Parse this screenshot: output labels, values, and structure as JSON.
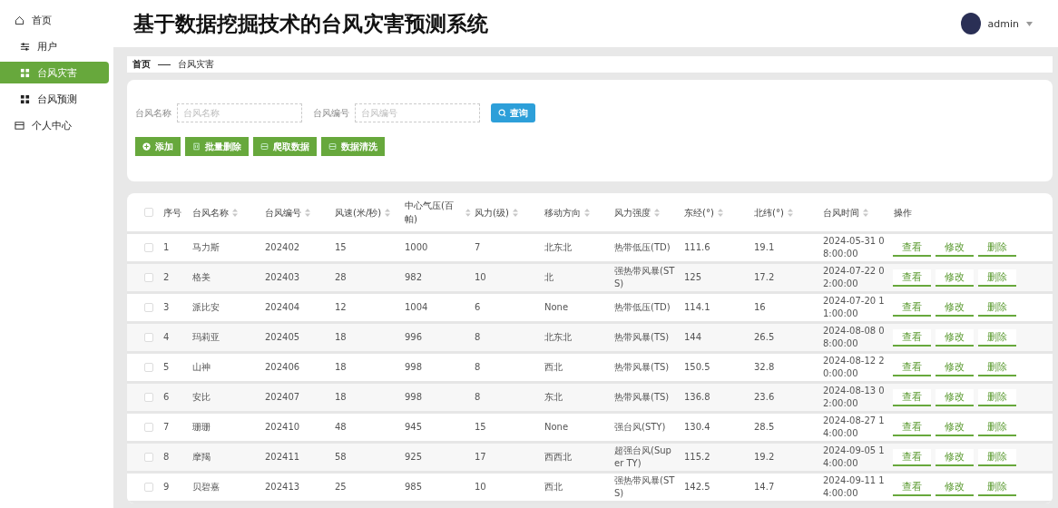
{
  "sidebar": {
    "items": [
      {
        "label": "首页",
        "kind": "home",
        "selected": false
      },
      {
        "label": "用户",
        "kind": "sliders",
        "selected": false
      },
      {
        "label": "台风灾害",
        "kind": "grid",
        "selected": true
      },
      {
        "label": "台风预测",
        "kind": "grid",
        "selected": false
      },
      {
        "label": "个人中心",
        "kind": "wallet",
        "selected": false
      }
    ]
  },
  "header": {
    "title": "基于数据挖掘技术的台风灾害预测系统",
    "user": "admin"
  },
  "breadcrumb": [
    "首页",
    "台风灾害"
  ],
  "search": {
    "fields": [
      {
        "label": "台风名称",
        "placeholder": "台风名称"
      },
      {
        "label": "台风编号",
        "placeholder": "台风编号"
      }
    ],
    "button": "查询"
  },
  "toolbar": [
    {
      "label": "添加",
      "kind": "plus"
    },
    {
      "label": "批量删除",
      "kind": "trash"
    },
    {
      "label": "爬取数据",
      "kind": "db"
    },
    {
      "label": "数据清洗",
      "kind": "db"
    }
  ],
  "table": {
    "header_checked": false,
    "columns": [
      {
        "label": "序号",
        "sortable": false
      },
      {
        "label": "台风名称",
        "sortable": true
      },
      {
        "label": "台风编号",
        "sortable": true
      },
      {
        "label": "风速(米/秒)",
        "sortable": true
      },
      {
        "label": "中心气压(百帕)",
        "sortable": true
      },
      {
        "label": "风力(级)",
        "sortable": true
      },
      {
        "label": "移动方向",
        "sortable": true
      },
      {
        "label": "风力强度",
        "sortable": true
      },
      {
        "label": "东经(°)",
        "sortable": true
      },
      {
        "label": "北纬(°)",
        "sortable": true
      },
      {
        "label": "台风时间",
        "sortable": true
      },
      {
        "label": "操作",
        "sortable": false
      }
    ],
    "rows": [
      {
        "checked": false,
        "cells": [
          "1",
          "马力斯",
          "202402",
          "15",
          "1000",
          "7",
          "北东北",
          "热带低压(TD)",
          "111.6",
          "19.1",
          "2024-05-31 08:00:00"
        ],
        "actions": [
          "查看",
          "修改",
          "删除"
        ]
      },
      {
        "checked": false,
        "cells": [
          "2",
          "格美",
          "202403",
          "28",
          "982",
          "10",
          "北",
          "强热带风暴(STS)",
          "125",
          "17.2",
          "2024-07-22 02:00:00"
        ],
        "actions": [
          "查看",
          "修改",
          "删除"
        ]
      },
      {
        "checked": false,
        "cells": [
          "3",
          "派比安",
          "202404",
          "12",
          "1004",
          "6",
          "None",
          "热带低压(TD)",
          "114.1",
          "16",
          "2024-07-20 11:00:00"
        ],
        "actions": [
          "查看",
          "修改",
          "删除"
        ]
      },
      {
        "checked": false,
        "cells": [
          "4",
          "玛莉亚",
          "202405",
          "18",
          "996",
          "8",
          "北东北",
          "热带风暴(TS)",
          "144",
          "26.5",
          "2024-08-08 08:00:00"
        ],
        "actions": [
          "查看",
          "修改",
          "删除"
        ]
      },
      {
        "checked": false,
        "cells": [
          "5",
          "山神",
          "202406",
          "18",
          "998",
          "8",
          "西北",
          "热带风暴(TS)",
          "150.5",
          "32.8",
          "2024-08-12 20:00:00"
        ],
        "actions": [
          "查看",
          "修改",
          "删除"
        ]
      },
      {
        "checked": false,
        "cells": [
          "6",
          "安比",
          "202407",
          "18",
          "998",
          "8",
          "东北",
          "热带风暴(TS)",
          "136.8",
          "23.6",
          "2024-08-13 02:00:00"
        ],
        "actions": [
          "查看",
          "修改",
          "删除"
        ]
      },
      {
        "checked": false,
        "cells": [
          "7",
          "珊珊",
          "202410",
          "48",
          "945",
          "15",
          "None",
          "强台风(STY)",
          "130.4",
          "28.5",
          "2024-08-27 14:00:00"
        ],
        "actions": [
          "查看",
          "修改",
          "删除"
        ]
      },
      {
        "checked": false,
        "cells": [
          "8",
          "摩羯",
          "202411",
          "58",
          "925",
          "17",
          "西西北",
          "超强台风(Super TY)",
          "115.2",
          "19.2",
          "2024-09-05 14:00:00"
        ],
        "actions": [
          "查看",
          "修改",
          "删除"
        ]
      },
      {
        "checked": false,
        "cells": [
          "9",
          "贝碧嘉",
          "202413",
          "25",
          "985",
          "10",
          "西北",
          "强热带风暴(STS)",
          "142.5",
          "14.7",
          "2024-09-11 14:00:00"
        ],
        "actions": [
          "查看",
          "修改",
          "删除"
        ]
      }
    ]
  }
}
